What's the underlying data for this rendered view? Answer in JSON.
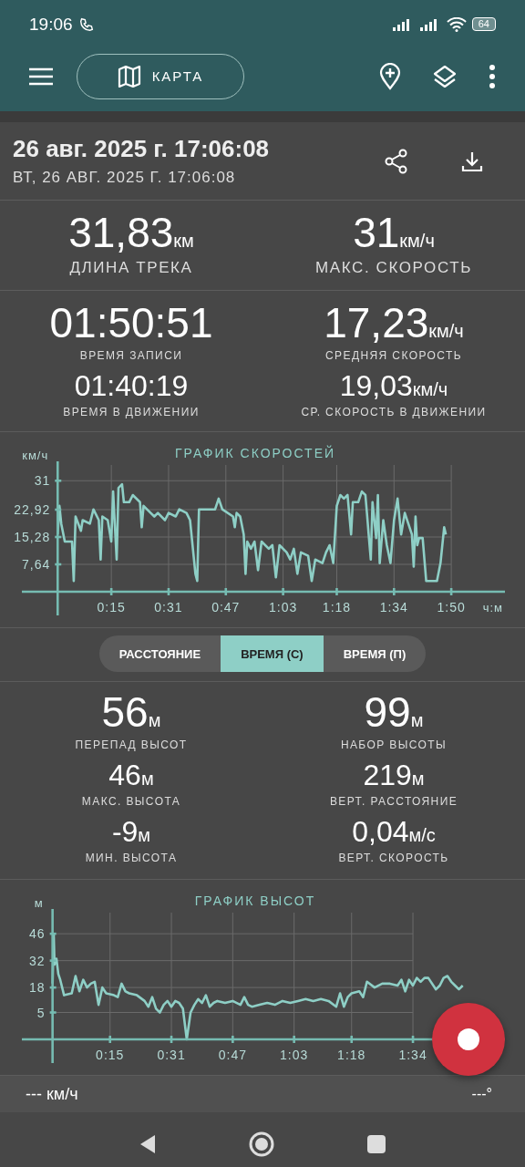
{
  "status_bar": {
    "time": "19:06",
    "battery": "64"
  },
  "toolbar": {
    "map_button": "КАРТА"
  },
  "track": {
    "title": "26 авг. 2025 г. 17:06:08",
    "subtitle": "ВТ, 26 АВГ. 2025 Г. 17:06:08"
  },
  "summary": [
    {
      "kind": "large",
      "value": "31,83",
      "unit": "км",
      "label": "ДЛИНА ТРЕКА"
    },
    {
      "kind": "large",
      "value": "31",
      "unit": "км/ч",
      "label": "МАКС. СКОРОСТЬ"
    }
  ],
  "times": [
    {
      "kind": "primary",
      "value": "01:50:51",
      "label": "ВРЕМЯ ЗАПИСИ"
    },
    {
      "kind": "primary",
      "value": "17,23",
      "unit": "км/ч",
      "label": "СРЕДНЯЯ СКОРОСТЬ"
    },
    {
      "kind": "secondary",
      "value": "01:40:19",
      "label": "ВРЕМЯ В ДВИЖЕНИИ"
    },
    {
      "kind": "secondary",
      "value": "19,03",
      "unit": "км/ч",
      "label": "СР. СКОРОСТЬ В ДВИЖЕНИИ"
    }
  ],
  "speed_chart": {
    "chart_data": {
      "type": "line",
      "title": "ГРАФИК СКОРОСТЕЙ",
      "ylabel": "км/ч",
      "xlabel": "ч:м",
      "xlim": [
        -10,
        125
      ],
      "ylim": [
        0,
        35.4
      ],
      "grid": true,
      "xticks": [
        {
          "value": 15,
          "label": "0:15"
        },
        {
          "value": 31,
          "label": "0:31"
        },
        {
          "value": 47,
          "label": "0:47"
        },
        {
          "value": 63,
          "label": "1:03"
        },
        {
          "value": 78,
          "label": "1:18"
        },
        {
          "value": 94,
          "label": "1:34"
        },
        {
          "value": 110,
          "label": "1:50"
        }
      ],
      "yticks": [
        {
          "value": 7.64,
          "label": "7,64"
        },
        {
          "value": 15.28,
          "label": "15,28"
        },
        {
          "value": 22.92,
          "label": "22,92"
        },
        {
          "value": 31,
          "label": "31"
        }
      ],
      "x": [
        0,
        0.5,
        1,
        2,
        4,
        4.5,
        5,
        6.5,
        7,
        9,
        10,
        11.5,
        12,
        12.5,
        14,
        15,
        15.5,
        16.5,
        17,
        18,
        18.5,
        20,
        21,
        23,
        23.5,
        24,
        26,
        27,
        28,
        30,
        31,
        33,
        34,
        36,
        37,
        38.5,
        39,
        39.5,
        41,
        44,
        45,
        46,
        49,
        49.5,
        50,
        51,
        52,
        52.5,
        53,
        54,
        55,
        56,
        57,
        59,
        60,
        61,
        62,
        64,
        65,
        66,
        67,
        68,
        70,
        71,
        72,
        74,
        75,
        76,
        77,
        78,
        79,
        80,
        81,
        82,
        82.5,
        84,
        85,
        86,
        86.5,
        87,
        87.5,
        88,
        89,
        89.5,
        90,
        91,
        92,
        93,
        94,
        95,
        96,
        97,
        98,
        99,
        99.5,
        100,
        100.5,
        101,
        102,
        103,
        106,
        107,
        108,
        108.5
      ],
      "series": [
        {
          "color": "#8ecfc6",
          "values": [
            16,
            24,
            19,
            14,
            14,
            3,
            21,
            17,
            20,
            19,
            23,
            20,
            9,
            21,
            20,
            14,
            28,
            9,
            29,
            30,
            25,
            25,
            27,
            25,
            18,
            24,
            22,
            21,
            22,
            20,
            22,
            21,
            23,
            22,
            20,
            5,
            3,
            23,
            23,
            23,
            26,
            23,
            21,
            18,
            22,
            21,
            16,
            5,
            14,
            12,
            14,
            6,
            14,
            12,
            13,
            4,
            13,
            11,
            9,
            12,
            5,
            11,
            10,
            3,
            9,
            8,
            11,
            13,
            8,
            24,
            27,
            26,
            27,
            16,
            25,
            25,
            28,
            27,
            21,
            15,
            9,
            25,
            15,
            27,
            8,
            20,
            13,
            8,
            20,
            26,
            16,
            22,
            19,
            16,
            7,
            21,
            13,
            15,
            15,
            3,
            3,
            8,
            18,
            16
          ]
        }
      ]
    }
  },
  "mode_tabs": [
    {
      "label": "РАССТОЯНИЕ",
      "selected": false
    },
    {
      "label": "ВРЕМЯ (С)",
      "selected": true
    },
    {
      "label": "ВРЕМЯ (П)",
      "selected": false
    }
  ],
  "altitude_stats": [
    {
      "kind": "large",
      "value": "56",
      "unit": "м",
      "label": "ПЕРЕПАД ВЫСОТ"
    },
    {
      "kind": "large",
      "value": "99",
      "unit": "м",
      "label": "НАБОР ВЫСОТЫ"
    },
    {
      "kind": "medium",
      "value": "46",
      "unit": "м",
      "label": "МАКС. ВЫСОТА"
    },
    {
      "kind": "medium",
      "value": "219",
      "unit": "м",
      "label": "ВЕРТ. РАССТОЯНИЕ"
    },
    {
      "kind": "medium",
      "value": "-9",
      "unit": "м",
      "label": "МИН. ВЫСОТА"
    },
    {
      "kind": "medium",
      "value": "0,04",
      "unit": "м/с",
      "label": "ВЕРТ. СКОРОСТЬ"
    }
  ],
  "altitude_chart": {
    "chart_data": {
      "type": "line",
      "title": "ГРАФИК ВЫСОТ",
      "ylabel": "м",
      "xlim": [
        -8,
        118
      ],
      "ylim": [
        -9,
        57
      ],
      "grid": true,
      "xticks": [
        {
          "value": 15,
          "label": "0:15"
        },
        {
          "value": 31,
          "label": "0:31"
        },
        {
          "value": 47,
          "label": "0:47"
        },
        {
          "value": 63,
          "label": "1:03"
        },
        {
          "value": 78,
          "label": "1:18"
        },
        {
          "value": 94,
          "label": "1:34"
        }
      ],
      "yticks": [
        5,
        18,
        32,
        46
      ],
      "x": [
        0,
        0.3,
        0.5,
        1,
        1.5,
        2,
        3,
        5,
        6,
        7,
        8,
        9,
        10,
        11,
        12,
        13,
        14,
        16,
        17,
        18,
        19,
        20,
        22,
        24,
        25,
        26,
        27,
        28,
        29,
        30,
        31,
        32,
        33,
        34,
        35,
        36,
        37,
        38,
        39,
        40,
        41,
        42,
        43,
        45,
        47,
        49,
        50,
        51,
        52,
        54,
        56,
        58,
        60,
        62,
        64,
        66,
        68,
        70,
        72,
        74,
        75,
        76,
        77,
        78,
        80,
        81,
        82,
        84,
        86,
        88,
        90,
        91,
        92,
        93,
        94,
        95,
        96,
        97,
        98,
        100,
        101,
        102,
        103,
        104,
        105,
        106,
        107
      ],
      "series": [
        {
          "color": "#8ecfc6",
          "values": [
            20,
            46,
            30,
            33,
            25,
            22,
            14,
            15,
            24,
            16,
            22,
            18,
            20,
            21,
            9,
            18,
            15,
            14,
            13,
            20,
            16,
            15,
            14,
            11,
            8,
            13,
            7,
            5,
            9,
            11,
            8,
            11,
            10,
            7,
            -9,
            5,
            9,
            12,
            10,
            14,
            8,
            10,
            11,
            10,
            11,
            9,
            13,
            9,
            8,
            9,
            10,
            9,
            11,
            10,
            11,
            12,
            11,
            12,
            11,
            8,
            15,
            8,
            13,
            15,
            16,
            13,
            21,
            18,
            20,
            20,
            19,
            22,
            16,
            22,
            19,
            23,
            21,
            23,
            23,
            17,
            19,
            23,
            24,
            21,
            19,
            17,
            19
          ]
        }
      ]
    }
  },
  "bottom_bar": {
    "speed": "--- км/ч",
    "heading": "---°"
  }
}
